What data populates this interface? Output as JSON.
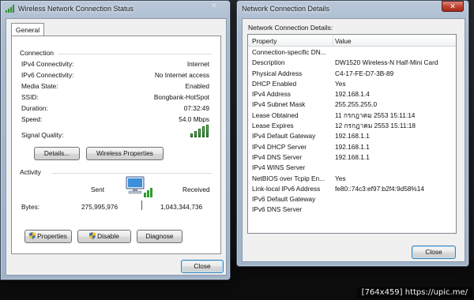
{
  "status_window": {
    "title": "Wireless Network Connection Status",
    "close_glyph": "✕",
    "tab": "General",
    "connection_group": "Connection",
    "rows": [
      {
        "label": "IPv4 Connectivity:",
        "value": "Internet"
      },
      {
        "label": "IPv6 Connectivity:",
        "value": "No Internet access"
      },
      {
        "label": "Media State:",
        "value": "Enabled"
      },
      {
        "label": "SSID:",
        "value": "Bongbank-HotSpot"
      },
      {
        "label": "Duration:",
        "value": "07:32:49"
      },
      {
        "label": "Speed:",
        "value": "54.0 Mbps"
      }
    ],
    "signal_label": "Signal Quality:",
    "signal_bars_filled": 5,
    "signal_bars_total": 5,
    "details_button": "Details...",
    "wireless_properties_button": "Wireless Properties",
    "activity_group": "Activity",
    "sent_label": "Sent",
    "received_label": "Received",
    "bytes_label": "Bytes:",
    "bytes_sent": "275,995,976",
    "bytes_received": "1,043,344,736",
    "properties_button": "Properties",
    "disable_button": "Disable",
    "diagnose_button": "Diagnose",
    "close_button": "Close"
  },
  "details_window": {
    "title": "Network Connection Details",
    "close_glyph": "✕",
    "caption": "Network Connection Details:",
    "columns": [
      "Property",
      "Value"
    ],
    "rows": [
      {
        "property": "Connection-specific DN...",
        "value": ""
      },
      {
        "property": "Description",
        "value": "DW1520 Wireless-N Half-Mini Card"
      },
      {
        "property": "Physical Address",
        "value": "C4-17-FE-D7-3B-89"
      },
      {
        "property": "DHCP Enabled",
        "value": "Yes"
      },
      {
        "property": "IPv4 Address",
        "value": "192.168.1.4"
      },
      {
        "property": "IPv4 Subnet Mask",
        "value": "255.255.255.0"
      },
      {
        "property": "Lease Obtained",
        "value": "11 กรกฎาคม 2553 15:11:14"
      },
      {
        "property": "Lease Expires",
        "value": "12 กรกฎาคม 2553 15:11:18"
      },
      {
        "property": "IPv4 Default Gateway",
        "value": "192.168.1.1"
      },
      {
        "property": "IPv4 DHCP Server",
        "value": "192.168.1.1"
      },
      {
        "property": "IPv4 DNS Server",
        "value": "192.168.1.1"
      },
      {
        "property": "IPv4 WINS Server",
        "value": ""
      },
      {
        "property": "NetBIOS over Tcpip En...",
        "value": "Yes"
      },
      {
        "property": "Link-local IPv6 Address",
        "value": "fe80::74c3:ef97:b2f4:9d58%14"
      },
      {
        "property": "IPv6 Default Gateway",
        "value": ""
      },
      {
        "property": "IPv6 DNS Server",
        "value": ""
      }
    ],
    "close_button": "Close"
  },
  "watermark": "[764x459] https://upic.me/",
  "colors": {
    "signal_green": "#2e9e2e",
    "close_red": "#c0402f",
    "window_frame": "#a9bbd0",
    "shield_blue": "#3f6fb6",
    "shield_yellow": "#f2c21b"
  },
  "icons": {
    "window_icon": "signal-bars-icon",
    "activity_icon": "computer-network-icon",
    "button_shield": "uac-shield-icon"
  }
}
